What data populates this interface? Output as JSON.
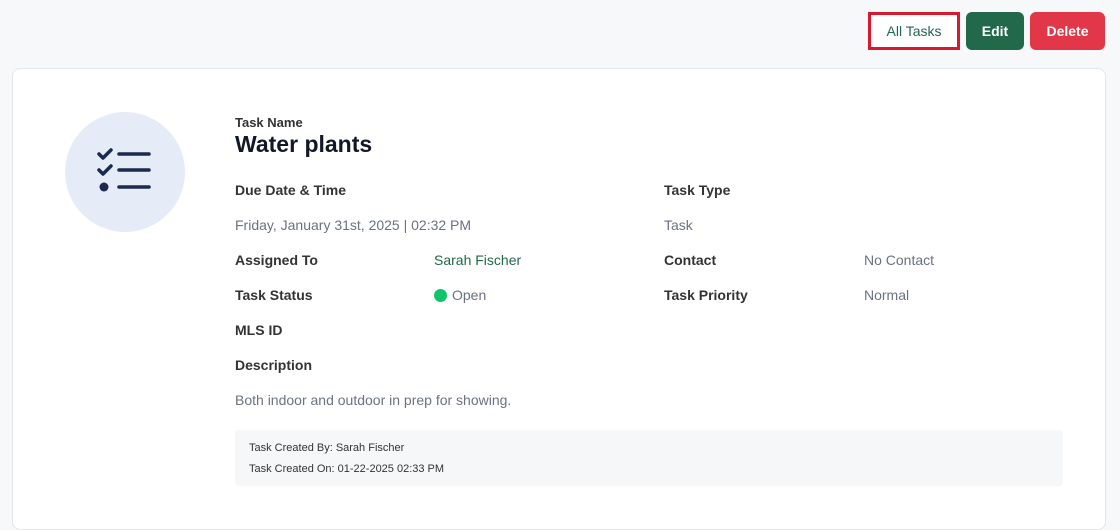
{
  "toolbar": {
    "all_tasks_label": "All Tasks",
    "edit_label": "Edit",
    "delete_label": "Delete"
  },
  "task": {
    "name_label": "Task Name",
    "name": "Water plants",
    "due_label": "Due Date & Time",
    "due_value": "Friday, January 31st, 2025 | 02:32 PM",
    "type_label": "Task Type",
    "type_value": "Task",
    "assigned_label": "Assigned To",
    "assigned_value": "Sarah Fischer",
    "contact_label": "Contact",
    "contact_value": "No Contact",
    "status_label": "Task Status",
    "status_value": "Open",
    "priority_label": "Task Priority",
    "priority_value": "Normal",
    "mls_label": "MLS ID",
    "description_label": "Description",
    "description_value": "Both indoor and outdoor in prep for showing.",
    "created_by": "Task Created By: Sarah Fischer",
    "created_on": "Task Created On: 01-22-2025 02:33 PM"
  },
  "icons": {
    "avatar": "checklist-icon",
    "status": "status-dot-icon"
  },
  "colors": {
    "accent_green": "#22684a",
    "danger_red": "#e23748",
    "status_open": "#10c46a",
    "highlight_border": "#d7192b",
    "avatar_bg": "#e6ecf7",
    "icon_navy": "#1b2a4e"
  }
}
